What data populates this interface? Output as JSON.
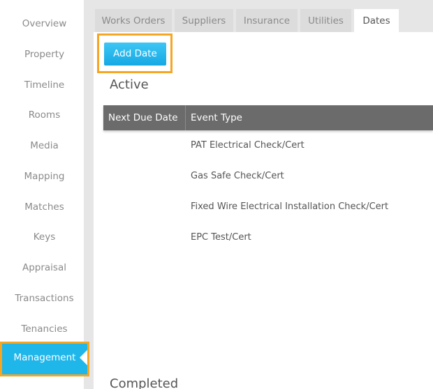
{
  "sidebar": {
    "items": [
      {
        "label": "Overview"
      },
      {
        "label": "Property"
      },
      {
        "label": "Timeline"
      },
      {
        "label": "Rooms"
      },
      {
        "label": "Media"
      },
      {
        "label": "Mapping"
      },
      {
        "label": "Matches"
      },
      {
        "label": "Keys"
      },
      {
        "label": "Appraisal"
      },
      {
        "label": "Transactions"
      },
      {
        "label": "Tenancies"
      },
      {
        "label": "Management"
      }
    ],
    "active": "Management"
  },
  "tabs": [
    {
      "label": "Works Orders"
    },
    {
      "label": "Suppliers"
    },
    {
      "label": "Insurance"
    },
    {
      "label": "Utilities"
    },
    {
      "label": "Dates"
    }
  ],
  "active_tab": "Dates",
  "toolbar": {
    "add_date_label": "Add Date"
  },
  "active_section": {
    "title": "Active",
    "columns": [
      "Next Due Date",
      "Event Type"
    ],
    "rows": [
      {
        "next_due_date": "",
        "event_type": "PAT Electrical Check/Cert"
      },
      {
        "next_due_date": "",
        "event_type": "Gas Safe Check/Cert"
      },
      {
        "next_due_date": "",
        "event_type": "Fixed Wire Electrical Installation Check/Cert"
      },
      {
        "next_due_date": "",
        "event_type": "EPC Test/Cert"
      }
    ]
  },
  "completed_section": {
    "title": "Completed"
  },
  "colors": {
    "accent": "#1fb6ea",
    "highlight": "#f5a623",
    "table_header": "#6b6b6b"
  }
}
